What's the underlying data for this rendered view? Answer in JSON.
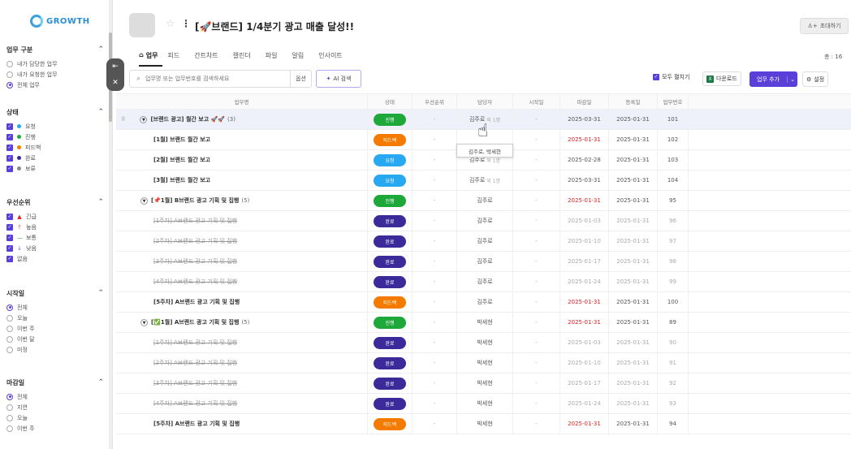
{
  "logo": "GROWTH",
  "sidebar": {
    "sections": [
      {
        "title": "업무 구분",
        "type": "radio",
        "items": [
          {
            "label": "내가 담당한 업무",
            "on": false
          },
          {
            "label": "내가 요청한 업무",
            "on": false
          },
          {
            "label": "전체 업무",
            "on": true
          }
        ]
      },
      {
        "title": "상태",
        "type": "check",
        "items": [
          {
            "label": "요청",
            "color": "#28a8f0"
          },
          {
            "label": "진행",
            "color": "#1fa83a"
          },
          {
            "label": "피드백",
            "color": "#f57a00"
          },
          {
            "label": "완료",
            "color": "#3a2a9a"
          },
          {
            "label": "보류",
            "color": "#888888"
          }
        ]
      },
      {
        "title": "우선순위",
        "type": "priority",
        "items": [
          {
            "label": "긴급",
            "icon": "▲",
            "color": "#d22"
          },
          {
            "label": "높음",
            "icon": "↑",
            "color": "#e55"
          },
          {
            "label": "보통",
            "icon": "—",
            "color": "#3a8e3a"
          },
          {
            "label": "낮음",
            "icon": "↓",
            "color": "#4a6aff"
          },
          {
            "label": "없음",
            "icon": "",
            "color": ""
          }
        ]
      },
      {
        "title": "시작일",
        "type": "radio",
        "items": [
          {
            "label": "전체",
            "on": true
          },
          {
            "label": "오늘",
            "on": false
          },
          {
            "label": "이번 주",
            "on": false
          },
          {
            "label": "이번 달",
            "on": false
          },
          {
            "label": "미정",
            "on": false
          }
        ]
      },
      {
        "title": "마감일",
        "type": "radio",
        "items": [
          {
            "label": "전체",
            "on": true
          },
          {
            "label": "지연",
            "on": false
          },
          {
            "label": "오늘",
            "on": false
          },
          {
            "label": "이번 주",
            "on": false
          }
        ]
      }
    ]
  },
  "header": {
    "title": "[🚀브랜드] 1/4분기 광고 매출 달성!!",
    "invite": "초대하기"
  },
  "tabs": [
    "업무",
    "피드",
    "간트차트",
    "캘린더",
    "파일",
    "알림",
    "인사이트"
  ],
  "total": "총 : 16",
  "toolbar": {
    "search_placeholder": "업무명 또는 업무번호를 검색하세요",
    "search_option": "옵션",
    "ai_search": "AI 검색",
    "expand_all": "모두 펼치기",
    "download": "다운로드",
    "add_task": "업무 추가",
    "settings": "설정"
  },
  "columns": [
    "업무명",
    "상태",
    "우선순위",
    "담당자",
    "시작일",
    "마감일",
    "등록일",
    "업무번호"
  ],
  "status_colors": {
    "진행": "#1fa83a",
    "피드백": "#f57a00",
    "요청": "#28a8f0",
    "완료": "#3a2a9a"
  },
  "rows": [
    {
      "name": "[브랜드 광고] 월간 보고 🚀🚀",
      "count": "(3)",
      "level": 0,
      "status": "진행",
      "priority": "-",
      "assignee": "김주로",
      "extra": "외 1명",
      "start": "-",
      "due": "2025-03-31",
      "due_red": false,
      "reg": "2025-01-31",
      "no": "101",
      "strike": false,
      "sel": true
    },
    {
      "name": "[1월] 브랜드 월간 보고",
      "count": "",
      "level": 1,
      "status": "피드백",
      "priority": "-",
      "assignee": "",
      "extra": "",
      "start": "-",
      "due": "2025-01-31",
      "due_red": true,
      "reg": "2025-01-31",
      "no": "102",
      "strike": false,
      "sel": false
    },
    {
      "name": "[2월] 브랜드 월간 보고",
      "count": "",
      "level": 1,
      "status": "요청",
      "priority": "-",
      "assignee": "김주로",
      "extra": "외 1명",
      "start": "-",
      "due": "2025-02-28",
      "due_red": false,
      "reg": "2025-01-31",
      "no": "103",
      "strike": false,
      "sel": false
    },
    {
      "name": "[3월] 브랜드 월간 보고",
      "count": "",
      "level": 1,
      "status": "요청",
      "priority": "-",
      "assignee": "김주로",
      "extra": "외 1명",
      "start": "-",
      "due": "2025-03-31",
      "due_red": false,
      "reg": "2025-01-31",
      "no": "104",
      "strike": false,
      "sel": false
    },
    {
      "name": "[📌1월] B브랜드 광고 기획 및 집행",
      "count": "(5)",
      "level": 0,
      "status": "진행",
      "priority": "-",
      "assignee": "김주로",
      "extra": "",
      "start": "-",
      "due": "2025-01-31",
      "due_red": true,
      "reg": "2025-01-31",
      "no": "95",
      "strike": false,
      "sel": false
    },
    {
      "name": "[1주차] A브랜드 광고 기획 및 집행",
      "count": "",
      "level": 1,
      "status": "완료",
      "priority": "-",
      "assignee": "김주로",
      "extra": "",
      "start": "-",
      "due": "2025-01-03",
      "due_red": false,
      "reg": "2025-01-31",
      "no": "96",
      "strike": true,
      "sel": false
    },
    {
      "name": "[2주차] A브랜드 광고 기획 및 집행",
      "count": "",
      "level": 1,
      "status": "완료",
      "priority": "-",
      "assignee": "김주로",
      "extra": "",
      "start": "-",
      "due": "2025-01-10",
      "due_red": false,
      "reg": "2025-01-31",
      "no": "97",
      "strike": true,
      "sel": false
    },
    {
      "name": "[3주차] A브랜드 광고 기획 및 집행",
      "count": "",
      "level": 1,
      "status": "완료",
      "priority": "-",
      "assignee": "김주로",
      "extra": "",
      "start": "-",
      "due": "2025-01-17",
      "due_red": false,
      "reg": "2025-01-31",
      "no": "98",
      "strike": true,
      "sel": false
    },
    {
      "name": "[4주차] A브랜드 광고 기획 및 집행",
      "count": "",
      "level": 1,
      "status": "완료",
      "priority": "-",
      "assignee": "김주로",
      "extra": "",
      "start": "-",
      "due": "2025-01-24",
      "due_red": false,
      "reg": "2025-01-31",
      "no": "99",
      "strike": true,
      "sel": false
    },
    {
      "name": "[5주차] A브랜드 광고 기획 및 집행",
      "count": "",
      "level": 1,
      "status": "피드백",
      "priority": "-",
      "assignee": "김주로",
      "extra": "",
      "start": "-",
      "due": "2025-01-31",
      "due_red": true,
      "reg": "2025-01-31",
      "no": "100",
      "strike": false,
      "sel": false
    },
    {
      "name": "[✅1월] A브랜드 광고 기획 및 집행",
      "count": "(5)",
      "level": 0,
      "status": "진행",
      "priority": "-",
      "assignee": "박세현",
      "extra": "",
      "start": "-",
      "due": "2025-01-31",
      "due_red": true,
      "reg": "2025-01-31",
      "no": "89",
      "strike": false,
      "sel": false
    },
    {
      "name": "[1주차] A브랜드 광고 기획 및 집행",
      "count": "",
      "level": 1,
      "status": "완료",
      "priority": "-",
      "assignee": "박세현",
      "extra": "",
      "start": "-",
      "due": "2025-01-03",
      "due_red": false,
      "reg": "2025-01-31",
      "no": "90",
      "strike": true,
      "sel": false
    },
    {
      "name": "[2주차] A브랜드 광고 기획 및 집행",
      "count": "",
      "level": 1,
      "status": "완료",
      "priority": "-",
      "assignee": "박세현",
      "extra": "",
      "start": "-",
      "due": "2025-01-10",
      "due_red": false,
      "reg": "2025-01-31",
      "no": "91",
      "strike": true,
      "sel": false
    },
    {
      "name": "[3주차] A브랜드 광고 기획 및 집행",
      "count": "",
      "level": 1,
      "status": "완료",
      "priority": "-",
      "assignee": "박세현",
      "extra": "",
      "start": "-",
      "due": "2025-01-17",
      "due_red": false,
      "reg": "2025-01-31",
      "no": "92",
      "strike": true,
      "sel": false
    },
    {
      "name": "[4주차] A브랜드 광고 기획 및 집행",
      "count": "",
      "level": 1,
      "status": "완료",
      "priority": "-",
      "assignee": "박세현",
      "extra": "",
      "start": "-",
      "due": "2025-01-24",
      "due_red": false,
      "reg": "2025-01-31",
      "no": "93",
      "strike": true,
      "sel": false
    },
    {
      "name": "[5주차] A브랜드 광고 기획 및 집행",
      "count": "",
      "level": 1,
      "status": "피드백",
      "priority": "-",
      "assignee": "박세현",
      "extra": "",
      "start": "-",
      "due": "2025-01-31",
      "due_red": true,
      "reg": "2025-01-31",
      "no": "94",
      "strike": false,
      "sel": false
    }
  ],
  "tooltip": "김주로, 박세현"
}
